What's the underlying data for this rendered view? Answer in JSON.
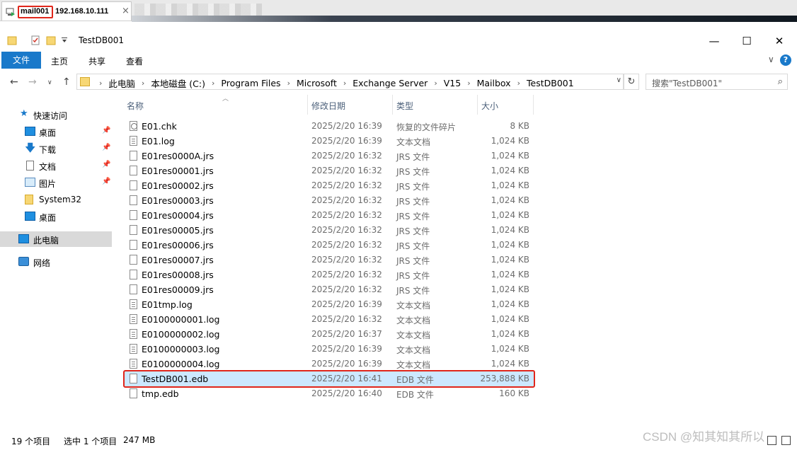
{
  "session": {
    "host": "mail001",
    "ip": "192.168.10.111",
    "close_symbol": "×"
  },
  "window": {
    "title": "TestDB001",
    "minimize": "—",
    "maximize": "☐",
    "close": "✕"
  },
  "ribbon": {
    "tabs": [
      "文件",
      "主页",
      "共享",
      "查看"
    ],
    "expand_symbol": "∨",
    "help_symbol": "?"
  },
  "address": {
    "breadcrumbs": [
      "此电脑",
      "本地磁盘 (C:)",
      "Program Files",
      "Microsoft",
      "Exchange Server",
      "V15",
      "Mailbox",
      "TestDB001"
    ],
    "search_placeholder": "搜索\"TestDB001\""
  },
  "sidebar": {
    "items": [
      {
        "label": "快速访问",
        "icon": "star-icon"
      },
      {
        "label": "桌面",
        "icon": "desktop-icon",
        "pinned": true
      },
      {
        "label": "下载",
        "icon": "download-icon",
        "pinned": true
      },
      {
        "label": "文档",
        "icon": "documents-icon",
        "pinned": true
      },
      {
        "label": "图片",
        "icon": "pictures-icon",
        "pinned": true
      },
      {
        "label": "System32",
        "icon": "folder-icon"
      },
      {
        "label": "桌面",
        "icon": "desktop-icon"
      },
      {
        "label": "此电脑",
        "icon": "computer-icon",
        "selected": true
      },
      {
        "label": "网络",
        "icon": "network-icon"
      }
    ]
  },
  "columns": {
    "name": "名称",
    "date": "修改日期",
    "type": "类型",
    "size": "大小"
  },
  "files": [
    {
      "name": "E01.chk",
      "date": "2025/2/20 16:39",
      "type": "恢复的文件碎片",
      "size": "8 KB",
      "icon": "chk"
    },
    {
      "name": "E01.log",
      "date": "2025/2/20 16:39",
      "type": "文本文档",
      "size": "1,024 KB",
      "icon": "text"
    },
    {
      "name": "E01res0000A.jrs",
      "date": "2025/2/20 16:32",
      "type": "JRS 文件",
      "size": "1,024 KB",
      "icon": "blank"
    },
    {
      "name": "E01res00001.jrs",
      "date": "2025/2/20 16:32",
      "type": "JRS 文件",
      "size": "1,024 KB",
      "icon": "blank"
    },
    {
      "name": "E01res00002.jrs",
      "date": "2025/2/20 16:32",
      "type": "JRS 文件",
      "size": "1,024 KB",
      "icon": "blank"
    },
    {
      "name": "E01res00003.jrs",
      "date": "2025/2/20 16:32",
      "type": "JRS 文件",
      "size": "1,024 KB",
      "icon": "blank"
    },
    {
      "name": "E01res00004.jrs",
      "date": "2025/2/20 16:32",
      "type": "JRS 文件",
      "size": "1,024 KB",
      "icon": "blank"
    },
    {
      "name": "E01res00005.jrs",
      "date": "2025/2/20 16:32",
      "type": "JRS 文件",
      "size": "1,024 KB",
      "icon": "blank"
    },
    {
      "name": "E01res00006.jrs",
      "date": "2025/2/20 16:32",
      "type": "JRS 文件",
      "size": "1,024 KB",
      "icon": "blank"
    },
    {
      "name": "E01res00007.jrs",
      "date": "2025/2/20 16:32",
      "type": "JRS 文件",
      "size": "1,024 KB",
      "icon": "blank"
    },
    {
      "name": "E01res00008.jrs",
      "date": "2025/2/20 16:32",
      "type": "JRS 文件",
      "size": "1,024 KB",
      "icon": "blank"
    },
    {
      "name": "E01res00009.jrs",
      "date": "2025/2/20 16:32",
      "type": "JRS 文件",
      "size": "1,024 KB",
      "icon": "blank"
    },
    {
      "name": "E01tmp.log",
      "date": "2025/2/20 16:39",
      "type": "文本文档",
      "size": "1,024 KB",
      "icon": "text"
    },
    {
      "name": "E0100000001.log",
      "date": "2025/2/20 16:32",
      "type": "文本文档",
      "size": "1,024 KB",
      "icon": "text"
    },
    {
      "name": "E0100000002.log",
      "date": "2025/2/20 16:37",
      "type": "文本文档",
      "size": "1,024 KB",
      "icon": "text"
    },
    {
      "name": "E0100000003.log",
      "date": "2025/2/20 16:39",
      "type": "文本文档",
      "size": "1,024 KB",
      "icon": "text"
    },
    {
      "name": "E0100000004.log",
      "date": "2025/2/20 16:39",
      "type": "文本文档",
      "size": "1,024 KB",
      "icon": "text"
    },
    {
      "name": "TestDB001.edb",
      "date": "2025/2/20 16:41",
      "type": "EDB 文件",
      "size": "253,888 KB",
      "icon": "blank",
      "selected": true
    },
    {
      "name": "tmp.edb",
      "date": "2025/2/20 16:40",
      "type": "EDB 文件",
      "size": "160 KB",
      "icon": "blank"
    }
  ],
  "status": {
    "count": "19 个项目",
    "selection": "选中 1 个项目",
    "selection_size": "247 MB"
  },
  "watermark": "CSDN @知其知其所以",
  "colors": {
    "accent": "#1979ca",
    "selection": "#cce8ff",
    "highlight": "#e0261b"
  }
}
